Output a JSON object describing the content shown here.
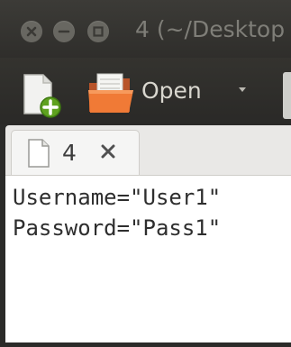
{
  "window": {
    "title": "4 (~/Desktop"
  },
  "toolbar": {
    "new_icon": "new-document-icon",
    "open_icon": "folder-open-icon",
    "open_label": "Open",
    "open_menu_icon": "chevron-down-icon"
  },
  "tabs": [
    {
      "label": "4",
      "icon": "document-icon",
      "close_glyph": "✕"
    }
  ],
  "editor": {
    "lines": [
      "Username=\"User1\"",
      "Password=\"Pass1\""
    ]
  }
}
